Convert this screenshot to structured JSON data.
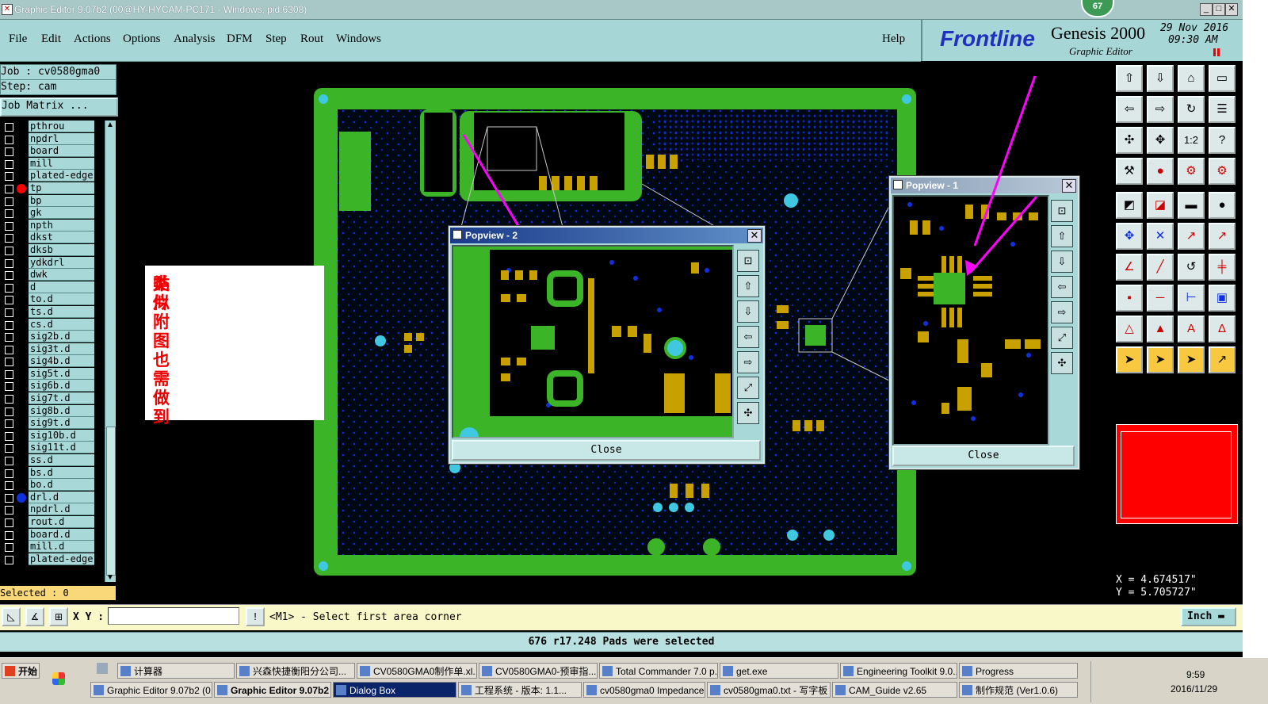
{
  "window": {
    "title": "Graphic Editor 9.07b2 (00@HY-HYCAM-PC171 - Windows, pid:6308)",
    "badge": "67"
  },
  "menu": [
    "File",
    "Edit",
    "Actions",
    "Options",
    "Analysis",
    "DFM",
    "Step",
    "Rout",
    "Windows"
  ],
  "help": "Help",
  "brand": {
    "logo": "Frontline",
    "product": "Genesis 2000",
    "subtitle": "Graphic Editor",
    "date": "29 Nov 2016",
    "time": "09:30 AM"
  },
  "job": {
    "job": "Job : cv0580gma0",
    "step": "Step: cam",
    "matrix": "Job Matrix ..."
  },
  "layers": [
    {
      "name": "pthrou",
      "mark": ""
    },
    {
      "name": "npdrl",
      "mark": ""
    },
    {
      "name": "board",
      "mark": ""
    },
    {
      "name": "mill",
      "mark": ""
    },
    {
      "name": "plated-edge",
      "mark": ""
    },
    {
      "name": "tp",
      "mark": "red"
    },
    {
      "name": "bp",
      "mark": ""
    },
    {
      "name": "gk",
      "mark": ""
    },
    {
      "name": "npth",
      "mark": ""
    },
    {
      "name": "dkst",
      "mark": ""
    },
    {
      "name": "dksb",
      "mark": ""
    },
    {
      "name": "ydkdrl",
      "mark": ""
    },
    {
      "name": "dwk",
      "mark": ""
    },
    {
      "name": "d",
      "mark": ""
    },
    {
      "name": "to.d",
      "mark": ""
    },
    {
      "name": "ts.d",
      "mark": ""
    },
    {
      "name": "cs.d",
      "mark": ""
    },
    {
      "name": "sig2b.d",
      "mark": ""
    },
    {
      "name": "sig3t.d",
      "mark": ""
    },
    {
      "name": "sig4b.d",
      "mark": ""
    },
    {
      "name": "sig5t.d",
      "mark": ""
    },
    {
      "name": "sig6b.d",
      "mark": ""
    },
    {
      "name": "sig7t.d",
      "mark": ""
    },
    {
      "name": "sig8b.d",
      "mark": ""
    },
    {
      "name": "sig9t.d",
      "mark": ""
    },
    {
      "name": "sig10b.d",
      "mark": ""
    },
    {
      "name": "sig11t.d",
      "mark": ""
    },
    {
      "name": "ss.d",
      "mark": ""
    },
    {
      "name": "bs.d",
      "mark": ""
    },
    {
      "name": "bo.d",
      "mark": ""
    },
    {
      "name": "drl.d",
      "mark": "blue"
    },
    {
      "name": "npdrl.d",
      "mark": ""
    },
    {
      "name": "rout.d",
      "mark": ""
    },
    {
      "name": "board.d",
      "mark": ""
    },
    {
      "name": "mill.d",
      "mark": ""
    },
    {
      "name": "plated-edge",
      "mark": ""
    }
  ],
  "selected": "Selected : 0",
  "annotation": {
    "line1": "类似附图也需做到",
    "line2": "贴片"
  },
  "popview2": {
    "title": "Popview - 2",
    "close": "Close"
  },
  "popview1": {
    "title": "Popview - 1",
    "close": "Close"
  },
  "coords": {
    "x": "X = 4.674517\"",
    "y": "Y = 5.705727\""
  },
  "cmd": {
    "xy_label": "X Y :",
    "xy_value": "",
    "prompt": "<M1> - Select first area corner",
    "units": "Inch"
  },
  "status": "676 r17.248 Pads were selected",
  "taskbar": {
    "start": "开始",
    "row1": [
      "计算器",
      "兴森快捷衡阳分公司...",
      "CV0580GMA0制作单.xl...",
      "CV0580GMA0-预审指...",
      "Total Commander 7.0 p...",
      "get.exe",
      "Engineering Toolkit 9.0...",
      "Progress"
    ],
    "row2": [
      "Graphic Editor 9.07b2 (0...",
      "Graphic Editor 9.07b2 ...",
      "Dialog Box",
      "工程系统 - 版本: 1.1...",
      "cv0580gma0 Impedance...",
      "cv0580gma0.txt - 写字板",
      "CAM_Guide v2.65",
      "制作规范 (Ver1.0.6)"
    ],
    "clock": "9:59",
    "date": "2016/11/29"
  },
  "colors": {
    "board": "#3cb428",
    "pad": "#c8a000",
    "via": "#1030e0",
    "magenta": "#ff00ff",
    "panel": "#a8d8d8"
  }
}
